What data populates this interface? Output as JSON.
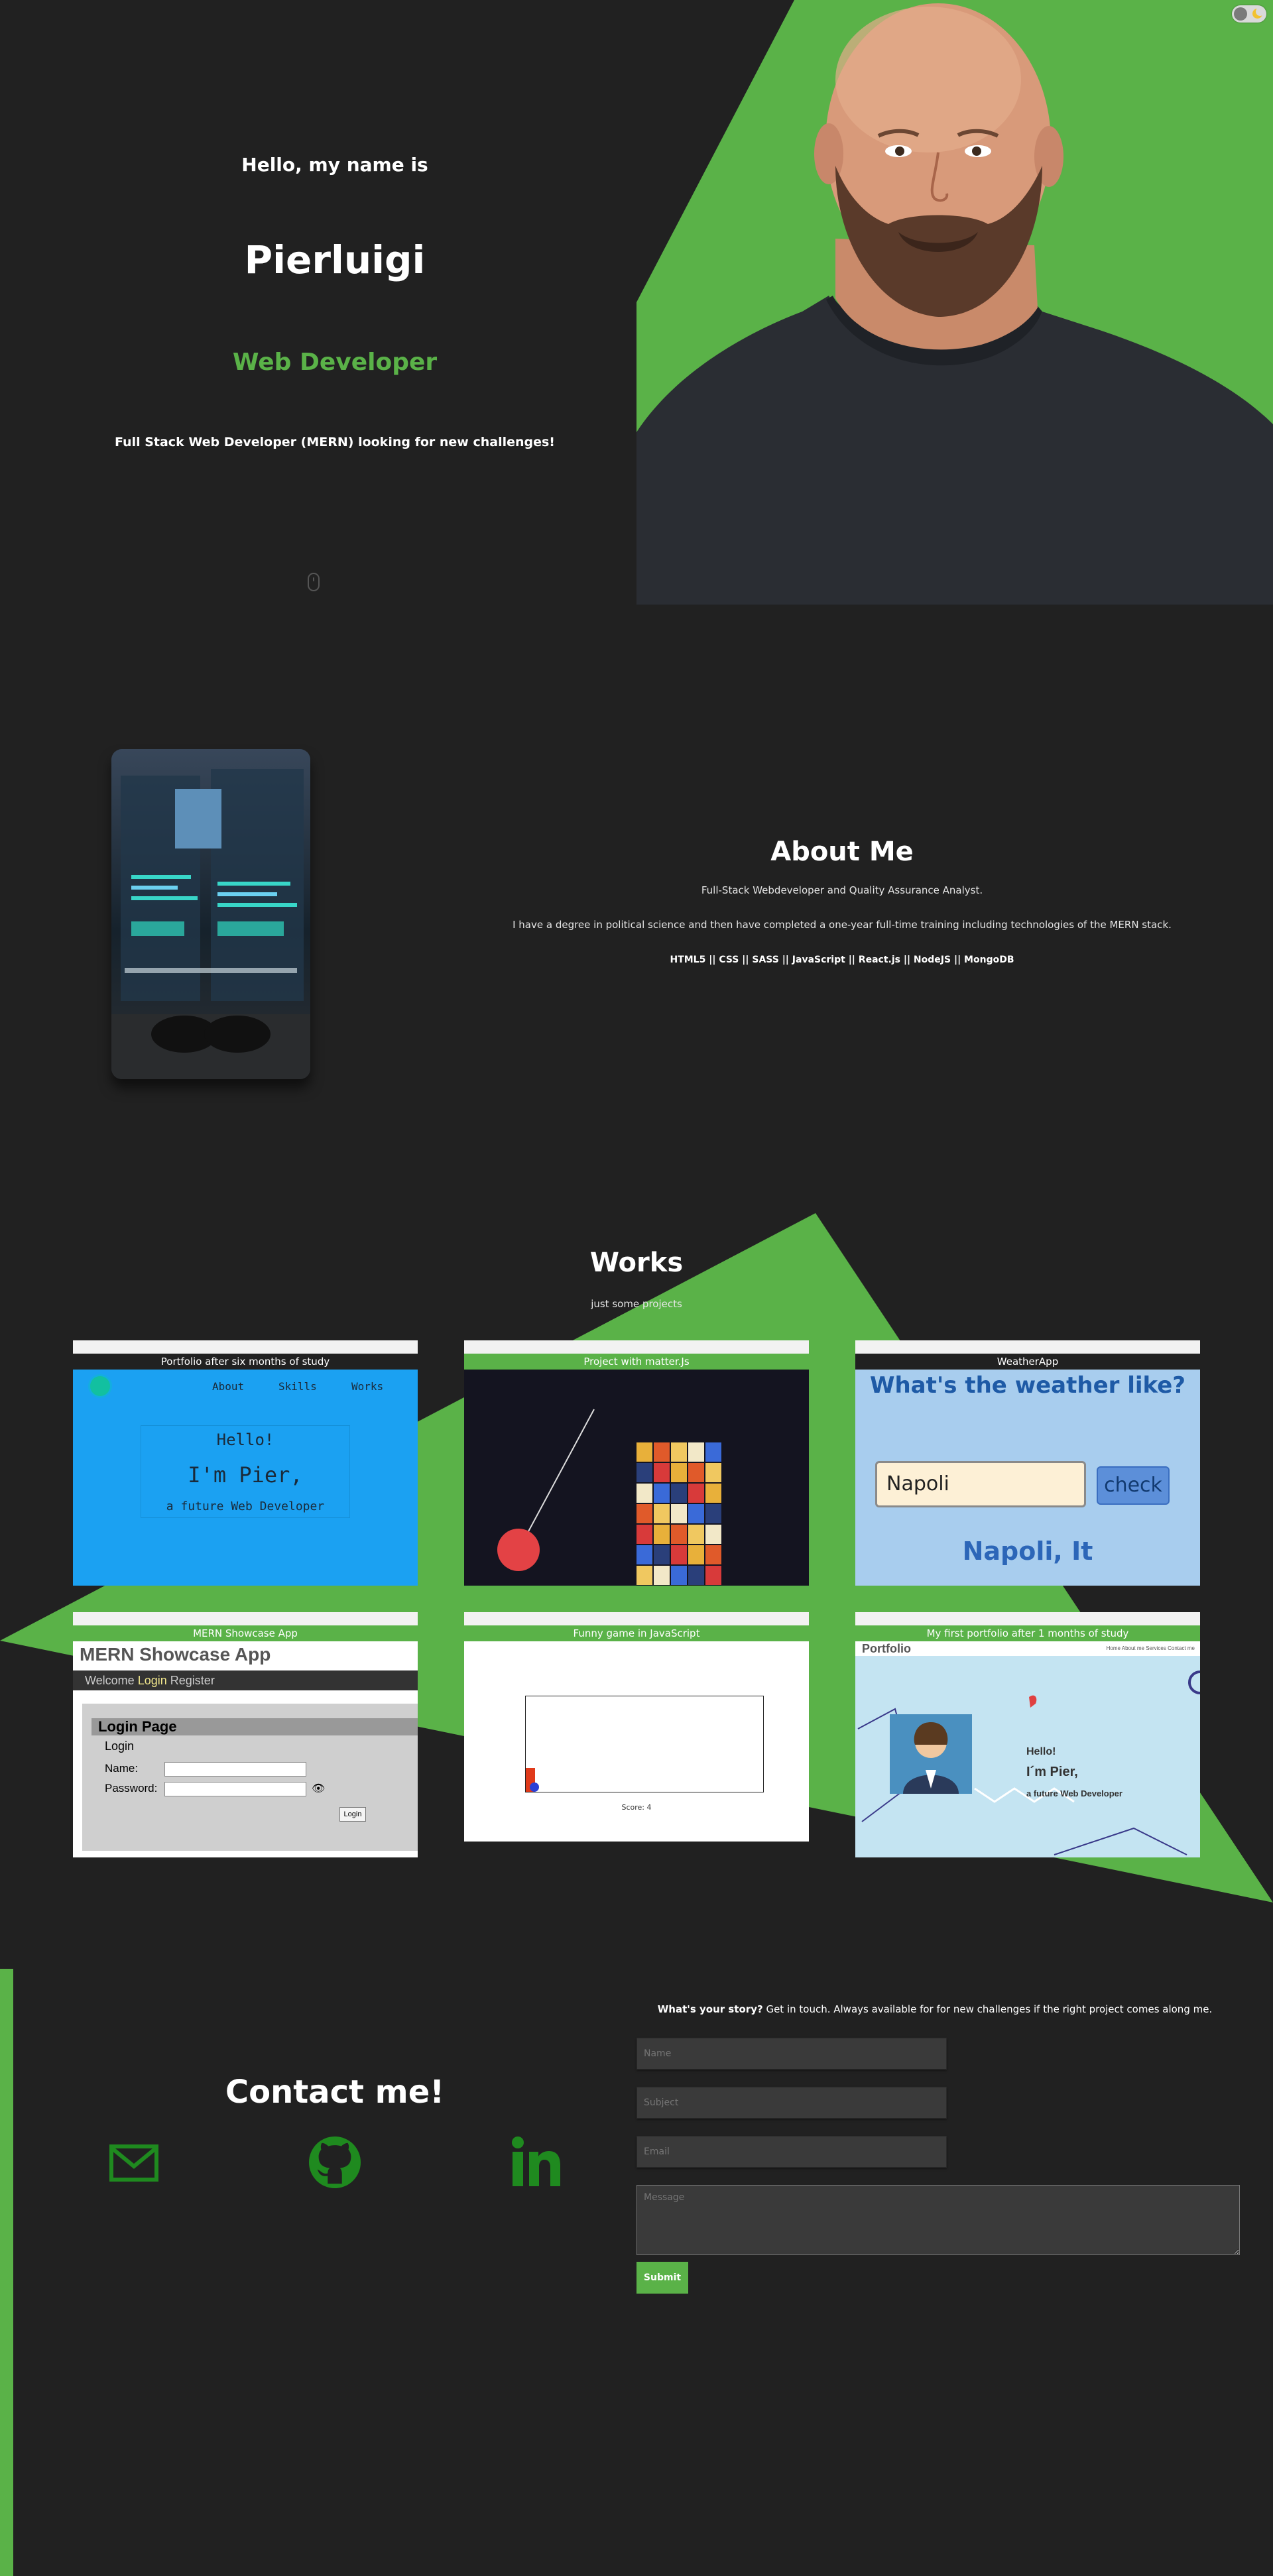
{
  "hero": {
    "greeting": "Hello, my name is",
    "name": "Pierluigi",
    "role": "Web Developer",
    "tagline": "Full Stack Web Developer (MERN) looking for new challenges!"
  },
  "about": {
    "title": "About Me",
    "paragraph1": "Full-Stack Webdeveloper and Quality Assurance Analyst.",
    "paragraph2": "I have a degree in political science and then have completed a one-year full-time training including technologies of the MERN stack.",
    "stack": "HTML5 || CSS || SASS || JavaScript || React.js || NodeJS || MongoDB"
  },
  "works": {
    "title": "Works",
    "subtitle": "just some projects",
    "projects": [
      {
        "caption": "Portfolio after six months of study",
        "nav": [
          "About",
          "Skills",
          "Works"
        ],
        "lines": [
          "Hello!",
          "I'm Pier,",
          "a future Web Developer"
        ]
      },
      {
        "caption": "Project with matter.Js"
      },
      {
        "caption": "WeatherApp",
        "question": "What's the weather like?",
        "input_value": "Napoli",
        "button": "check",
        "result": "Napoli, It"
      },
      {
        "caption": "MERN Showcase App",
        "heading": "MERN Showcase App",
        "nav_welcome": "Welcome",
        "nav_login": "Login",
        "nav_register": "Register",
        "panel_title": "Login Page",
        "form_title": "Login",
        "name_label": "Name:",
        "password_label": "Password:",
        "button": "Login"
      },
      {
        "caption": "Funny game in JavaScript",
        "score": "Score: 4"
      },
      {
        "caption": "My first portfolio after 1 months of study",
        "logo": "Portfolio",
        "menu": "Home About me Services Contact me",
        "lines": [
          "Hello!",
          "I´m Pier,",
          "a future Web Developer"
        ]
      }
    ]
  },
  "contact": {
    "title": "Contact me!",
    "icons": [
      "mail-icon",
      "github-icon",
      "linkedin-icon"
    ],
    "story_bold": "What's your story?",
    "story_rest": " Get in touch. Always available for for new challenges if the right project comes along me.",
    "name_placeholder": "Name",
    "subject_placeholder": "Subject",
    "email_placeholder": "Email",
    "message_placeholder": "Message",
    "submit": "Submit"
  },
  "colors": {
    "accent": "#5ab248",
    "background": "#212121",
    "icon_green": "#1f8a1f"
  }
}
